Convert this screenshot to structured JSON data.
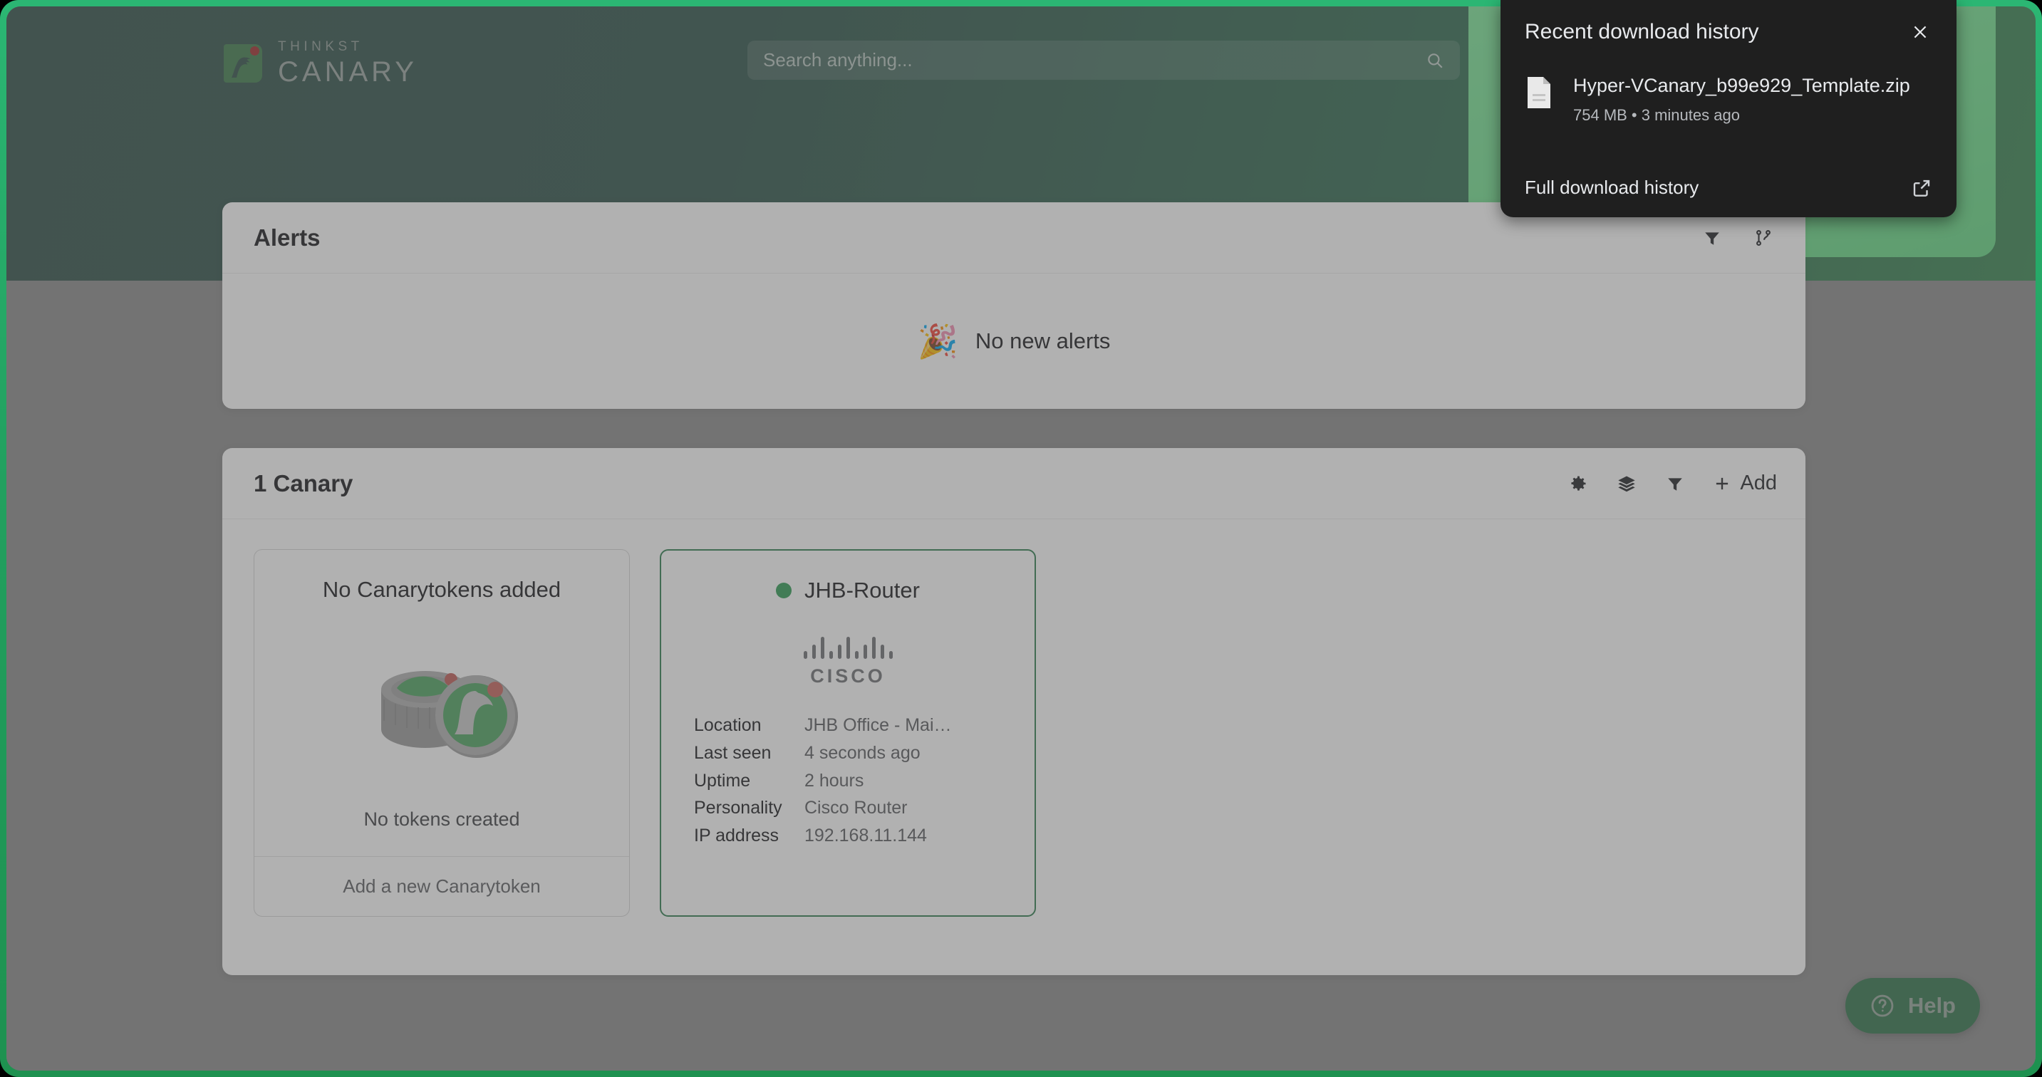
{
  "brand": {
    "thinkst": "THINKST",
    "canary": "CANARY",
    "logo_icon": "canary-bird-logo",
    "accent_green": "#2e7d4f",
    "frame_green": "#22a05f",
    "panel_green": "#6fe08d",
    "header_teal": "#2f4f47",
    "alert_dot_red": "#a02b2b"
  },
  "search": {
    "placeholder": "Search anything...",
    "value": "",
    "icon": "search-icon"
  },
  "alerts": {
    "title": "Alerts",
    "empty_text": "No new alerts",
    "empty_emoji": "🎉",
    "actions": [
      {
        "name": "filter-icon",
        "icon": "funnel"
      },
      {
        "name": "git-branch-icon",
        "icon": "branch"
      }
    ]
  },
  "canaries": {
    "title": "1 Canary",
    "actions": [
      {
        "name": "settings-icon",
        "icon": "gear"
      },
      {
        "name": "layers-icon",
        "icon": "stack"
      },
      {
        "name": "filter-icon",
        "icon": "funnel"
      }
    ],
    "add_label": "Add",
    "add_icon": "plus-icon",
    "token_tile": {
      "title": "No Canarytokens added",
      "art_icon": "canarytoken-coins-illustration",
      "subtitle": "No tokens created",
      "footer_label": "Add a new Canarytoken"
    },
    "device_tile": {
      "name": "JHB-Router",
      "status_color": "#2e9c53",
      "vendor_logo": "cisco-logo",
      "vendor_word": "CISCO",
      "fields": [
        {
          "label": "Location",
          "value": "JHB Office - Mai…"
        },
        {
          "label": "Last seen",
          "value": "4 seconds ago"
        },
        {
          "label": "Uptime",
          "value": "2 hours"
        },
        {
          "label": "Personality",
          "value": "Cisco Router"
        },
        {
          "label": "IP address",
          "value": "192.168.11.144"
        }
      ]
    }
  },
  "download_popup": {
    "title": "Recent download history",
    "close_icon": "close-icon",
    "file_icon": "file-icon",
    "filename": "Hyper-VCanary_b99e929_Template.zip",
    "meta": "754 MB • 3 minutes ago",
    "footer_label": "Full download history",
    "external_icon": "external-link-icon"
  },
  "help": {
    "label": "Help",
    "icon": "question-circle-icon"
  }
}
